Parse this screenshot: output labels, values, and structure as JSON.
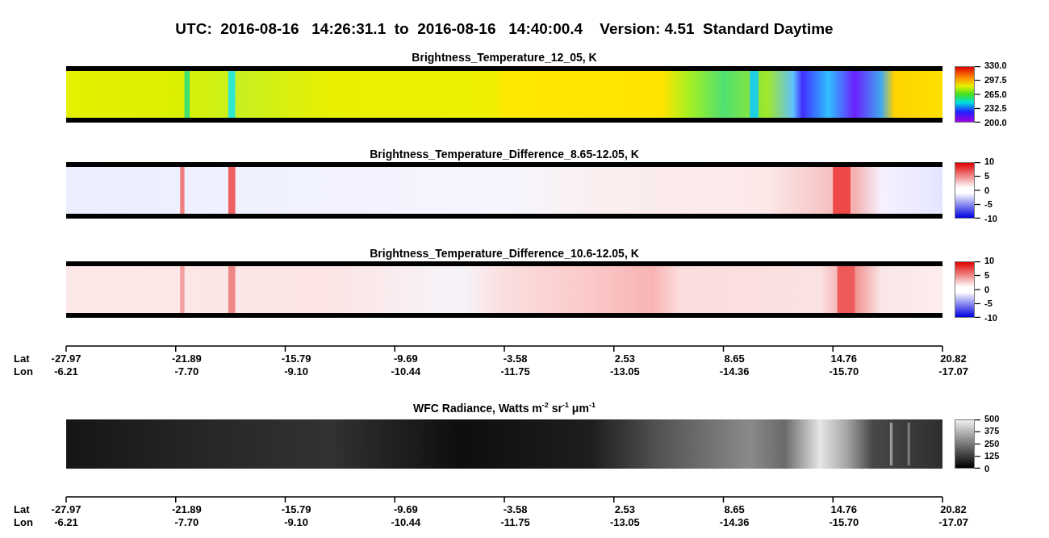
{
  "title": "UTC:  2016-08-16   14:26:31.1  to  2016-08-16   14:40:00.4    Version: 4.51  Standard Daytime",
  "rows": [
    {
      "kind": "panel",
      "title": "Brightness_Temperature_12_05, K",
      "colorbar": {
        "kind": "rainbow",
        "ticks": [
          "330.0",
          "297.5",
          "265.0",
          "232.5",
          "200.0"
        ]
      }
    },
    {
      "kind": "panel",
      "title": "Brightness_Temperature_Difference_8.65-12.05, K",
      "colorbar": {
        "kind": "diverging",
        "ticks": [
          "10",
          "5",
          "0",
          "-5",
          "-10"
        ]
      }
    },
    {
      "kind": "panel",
      "title": "Brightness_Temperature_Difference_10.6-12.05, K",
      "colorbar": {
        "kind": "diverging",
        "ticks": [
          "10",
          "5",
          "0",
          "-5",
          "-10"
        ]
      }
    },
    {
      "kind": "axis",
      "lines": [
        {
          "label": "Lat",
          "values": [
            "-27.97",
            "-21.89",
            "-15.79",
            "-9.69",
            "-3.58",
            "2.53",
            "8.65",
            "14.76",
            "20.82"
          ]
        },
        {
          "label": "Lon",
          "values": [
            "-6.21",
            "-7.70",
            "-9.10",
            "-10.44",
            "-11.75",
            "-13.05",
            "-14.36",
            "-15.70",
            "-17.07"
          ]
        }
      ]
    },
    {
      "kind": "panel",
      "title": "WFC Radiance, Watts m$^{-2}$ sr$^{-1}$ μm$^{-1}$",
      "colorbar": {
        "kind": "gray",
        "ticks": [
          "500",
          "375",
          "250",
          "125",
          "0"
        ]
      }
    },
    {
      "kind": "axis",
      "lines": [
        {
          "label": "Lat",
          "values": [
            "-27.97",
            "-21.89",
            "-15.79",
            "-9.69",
            "-3.58",
            "2.53",
            "8.65",
            "14.76",
            "20.82"
          ]
        },
        {
          "label": "Lon",
          "values": [
            "-6.21",
            "-7.70",
            "-9.10",
            "-10.44",
            "-11.75",
            "-13.05",
            "-14.36",
            "-15.70",
            "-17.07"
          ]
        }
      ]
    }
  ]
}
